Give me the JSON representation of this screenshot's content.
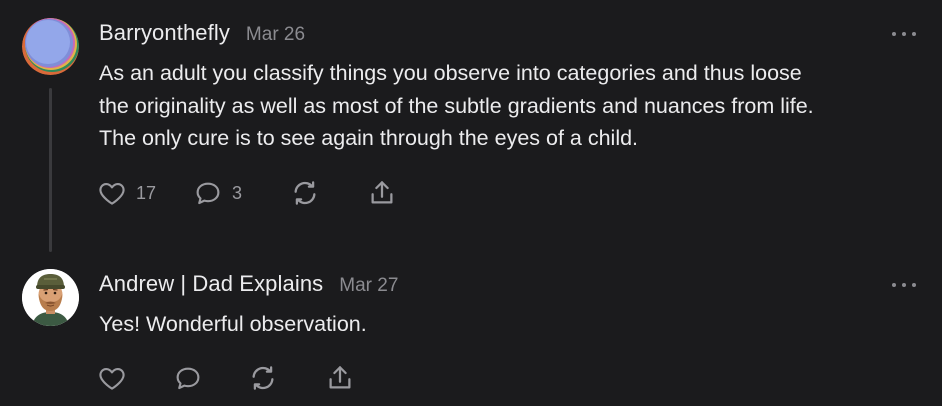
{
  "comments": [
    {
      "author": "Barryonthefly",
      "date": "Mar 26",
      "avatar_icon": "abstract-swirl-avatar",
      "text_lines": [
        "As an adult you classify things you observe into categories and thus loose",
        "the originality as well as most of the subtle gradients and nuances from life.",
        "The only cure is to see again through the eyes of a child."
      ],
      "likes": "17",
      "replies": "3"
    },
    {
      "author": "Andrew | Dad Explains",
      "date": "Mar 27",
      "avatar_icon": "bearded-man-avatar",
      "text_lines": [
        "Yes! Wonderful observation."
      ]
    }
  ],
  "icons": {
    "like": "heart-icon",
    "reply": "comment-bubble-icon",
    "restack": "restack-icon",
    "share": "share-icon",
    "more": "more-options-icon"
  },
  "colors": {
    "background": "#1b1b1d",
    "text": "#ececee",
    "muted": "#8b8b90",
    "icon": "#9a9a9f"
  }
}
